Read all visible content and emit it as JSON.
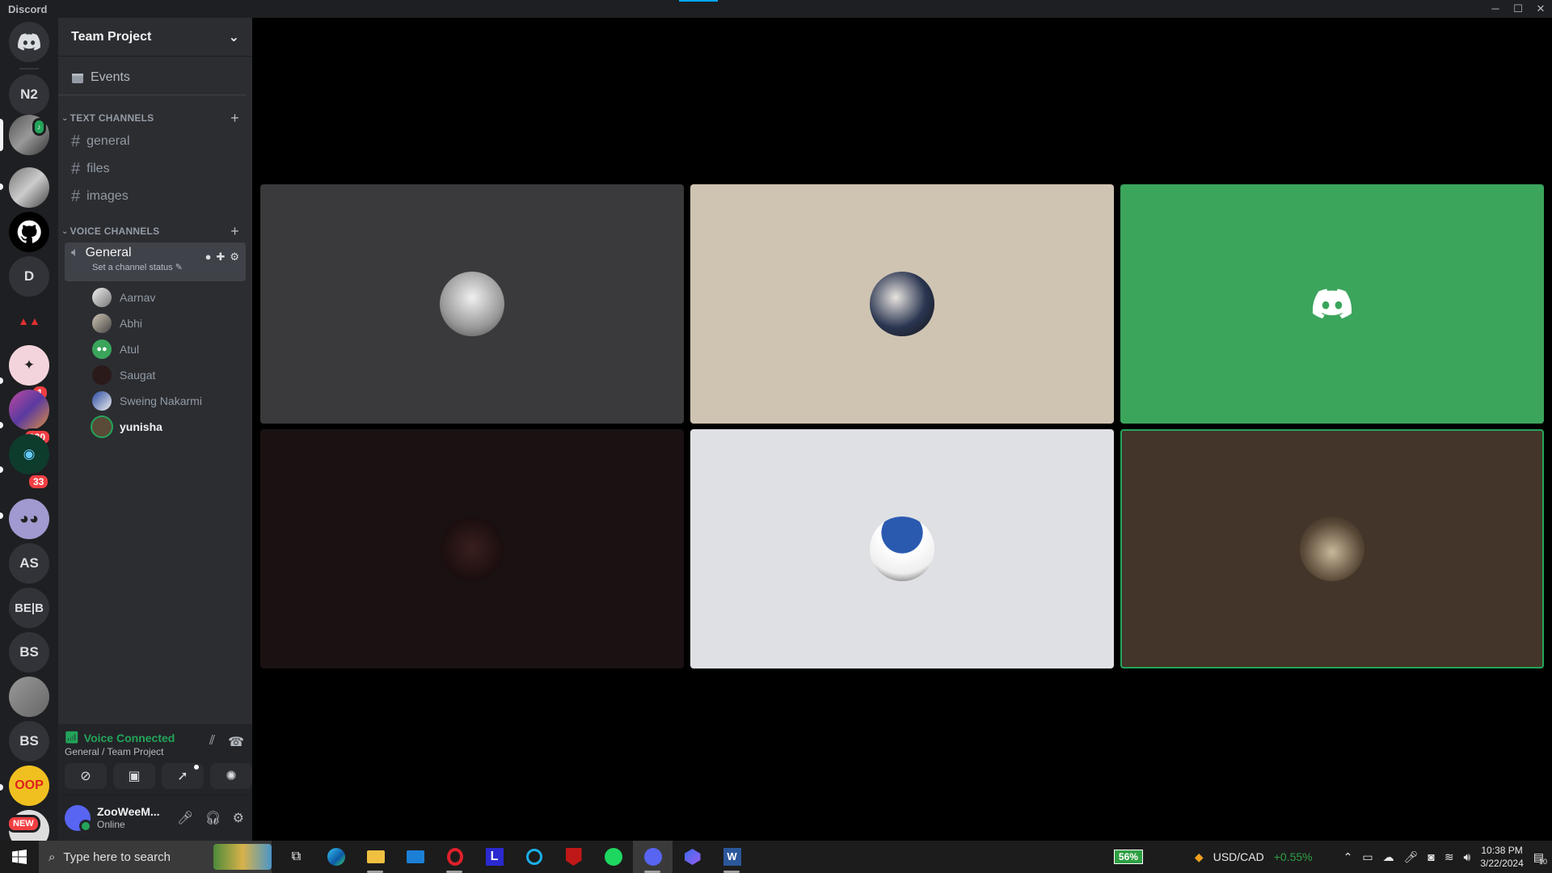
{
  "window": {
    "title": "Discord",
    "controls": [
      "─",
      "☐",
      "✕"
    ]
  },
  "guilds": [
    {
      "label": "",
      "kind": "home"
    },
    {
      "label": "N2"
    },
    {
      "label": "",
      "badge": ""
    },
    {
      "label": ""
    },
    {
      "label": ""
    },
    {
      "label": "D"
    },
    {
      "label": ""
    },
    {
      "label": "",
      "badge": "1"
    },
    {
      "label": "",
      "badge": "230"
    },
    {
      "label": "",
      "badge": "33"
    },
    {
      "label": ""
    },
    {
      "label": "AS"
    },
    {
      "label": "BE|B"
    },
    {
      "label": "BS"
    },
    {
      "label": ""
    },
    {
      "label": "BS"
    },
    {
      "label": "OOP"
    },
    {
      "label": "NEW"
    }
  ],
  "sidebar": {
    "server_name": "Team Project",
    "events_label": "Events",
    "text_category": "TEXT CHANNELS",
    "text_channels": [
      "general",
      "files",
      "images"
    ],
    "voice_category": "VOICE CHANNELS",
    "voice_channel": {
      "name": "General",
      "status_placeholder": "Set a channel status"
    },
    "members": [
      "Aarnav",
      "Abhi",
      "Atul",
      "Saugat",
      "Sweing Nakarmi",
      "yunisha"
    ]
  },
  "rtc": {
    "status": "Voice Connected",
    "location": "General / Team Project"
  },
  "user": {
    "name": "ZooWeeM...",
    "status": "Online"
  },
  "stage": {
    "tiles": [
      {
        "bg": "#3a393b"
      },
      {
        "bg": "#cfc4b2"
      },
      {
        "bg": "#3ba55c"
      },
      {
        "bg": "#1a1212"
      },
      {
        "bg": "#dfe0e4"
      },
      {
        "bg": "#433529"
      }
    ]
  },
  "taskbar": {
    "search_placeholder": "Type here to search",
    "battery": "56%",
    "ticker": "USD/CAD",
    "ticker_change": "+0.55%",
    "time": "10:38 PM",
    "date": "3/22/2024",
    "notifications": "10"
  }
}
